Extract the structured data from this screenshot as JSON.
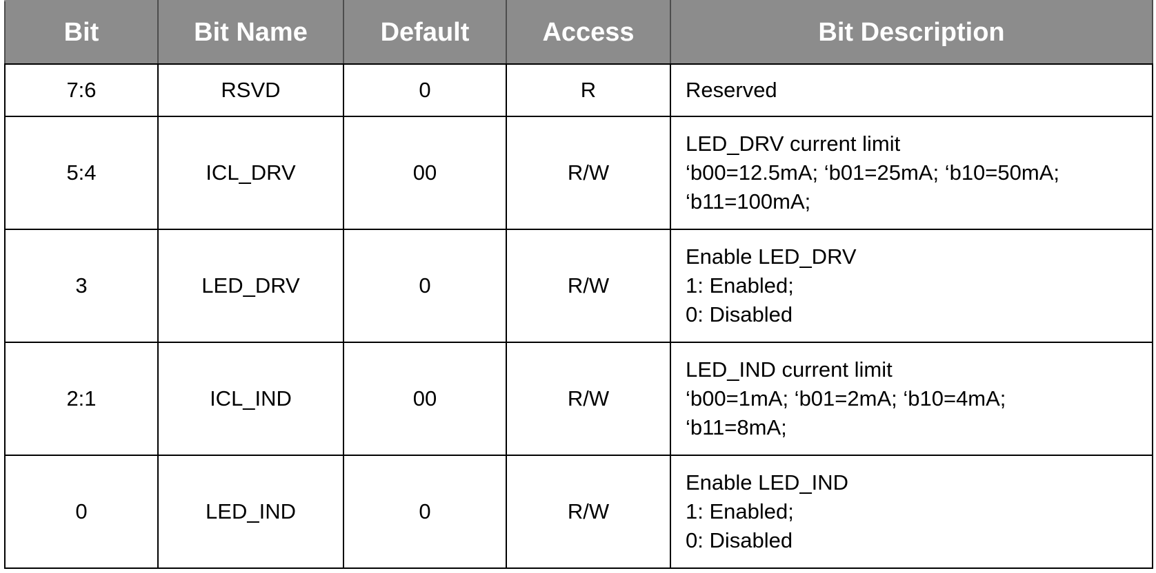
{
  "header": {
    "bit": "Bit",
    "bit_name": "Bit Name",
    "default": "Default",
    "access": "Access",
    "bit_description": "Bit Description"
  },
  "rows": [
    {
      "bit": "7:6",
      "name": "RSVD",
      "default": "0",
      "access": "R",
      "description": [
        "Reserved"
      ]
    },
    {
      "bit": "5:4",
      "name": "ICL_DRV",
      "default": "00",
      "access": "R/W",
      "description": [
        "LED_DRV current limit",
        "‘b00=12.5mA; ‘b01=25mA; ‘b10=50mA;",
        "‘b11=100mA;"
      ]
    },
    {
      "bit": "3",
      "name": "LED_DRV",
      "default": "0",
      "access": "R/W",
      "description": [
        "Enable LED_DRV",
        "1: Enabled;",
        "0: Disabled"
      ]
    },
    {
      "bit": "2:1",
      "name": "ICL_IND",
      "default": "00",
      "access": "R/W",
      "description": [
        "LED_IND current limit",
        "‘b00=1mA; ‘b01=2mA; ‘b10=4mA;",
        "‘b11=8mA;"
      ]
    },
    {
      "bit": "0",
      "name": "LED_IND",
      "default": "0",
      "access": "R/W",
      "description": [
        "Enable LED_IND",
        "1: Enabled;",
        "0: Disabled"
      ]
    }
  ]
}
